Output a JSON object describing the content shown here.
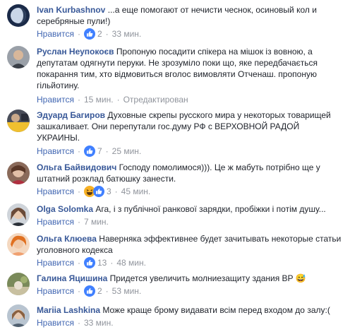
{
  "ui": {
    "like_label": "Нравится",
    "separator": "·"
  },
  "colors": {
    "author": "#385898",
    "link": "#4267b2",
    "meta": "#90949c",
    "like_blue": "#4080ff",
    "haha_yellow": "#f7b125"
  },
  "comments": [
    {
      "author": "Ivan Kurbashnov",
      "text": "...а еще помогают от нечисти чеснок, осиновый кол и серебряные пули!)",
      "reactions": [
        "like-icon"
      ],
      "reaction_count": "2",
      "time": "33 мин.",
      "edited": ""
    },
    {
      "author": "Руслан Неупокоєв",
      "text": "Пропоную посадити спікера на мішок із вовною, а депутатам одягнути перуки. Не зрозуміло поки що, яке передбачається покарання тим, хто відмовиться вголос вимовляти Отченаш. пропоную гільйотину.",
      "reactions": [],
      "reaction_count": "",
      "time": "15 мин.",
      "edited": "Отредактирован"
    },
    {
      "author": "Эдуард Багиров",
      "text": "Духовные скрепы русского мира у некоторых товарищей зашкаливает. Они перепутали гос.думу РФ с ВЕРХОВНОЙ РАДОЙ УКРАИНЫ.",
      "reactions": [
        "like-icon"
      ],
      "reaction_count": "7",
      "time": "25 мин.",
      "edited": ""
    },
    {
      "author": "Ольга Байвидович",
      "text": "Господу помолимося))). Це ж мабуть потрібно ще у штатний розклад батюшку занести.",
      "reactions": [
        "haha-icon",
        "like-icon"
      ],
      "reaction_count": "3",
      "time": "45 мин.",
      "edited": ""
    },
    {
      "author": "Olga Solomka",
      "text": "Ага, і з публічної ранкової зарядки, пробіжки і потім душу...",
      "reactions": [],
      "reaction_count": "",
      "time": "7 мин.",
      "edited": ""
    },
    {
      "author": "Ольга Клюева",
      "text": "Наверняка эффективнее будет зачитывать некоторые статьи уголовного кодекса",
      "reactions": [
        "like-icon"
      ],
      "reaction_count": "13",
      "time": "48 мин.",
      "edited": ""
    },
    {
      "author": "Галина Яцишина",
      "text": "Придется увеличить молниезащиту здания ВР 😅",
      "reactions": [
        "like-icon"
      ],
      "reaction_count": "2",
      "time": "53 мин.",
      "edited": ""
    },
    {
      "author": "Mariia Lashkina",
      "text": "Може краще брому видавати всім перед входом до залу:(",
      "reactions": [],
      "reaction_count": "",
      "time": "33 мин.",
      "edited": ""
    }
  ]
}
